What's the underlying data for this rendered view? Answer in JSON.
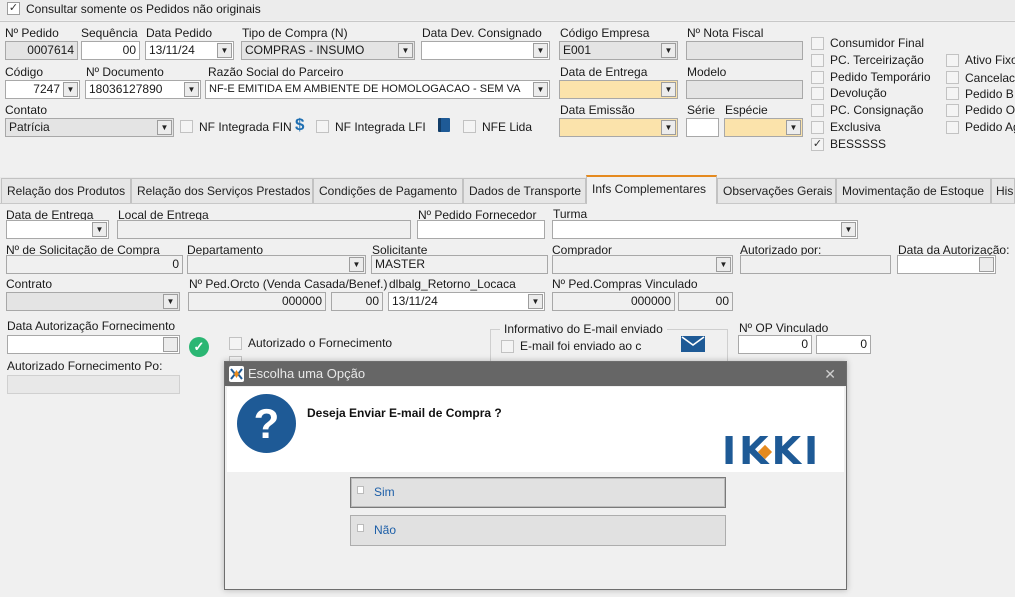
{
  "top_bar": {
    "checkbox_label": "Consultar somente os Pedidos não originais",
    "checked": true
  },
  "header": {
    "labels": {
      "pedido": "Nº Pedido",
      "sequencia": "Sequência",
      "data_pedido": "Data Pedido",
      "tipo_compra": "Tipo de Compra (N)",
      "data_dev": "Data Dev. Consignado",
      "codigo_empresa": "Código Empresa",
      "nota_fiscal": "Nº Nota Fiscal",
      "codigo": "Código",
      "documento": "Nº Documento",
      "razao_social": "Razão Social do Parceiro",
      "data_entrega": "Data de Entrega",
      "modelo": "Modelo",
      "contato": "Contato",
      "data_emissao": "Data Emissão",
      "serie": "Série",
      "especie": "Espécie"
    },
    "values": {
      "pedido": "0007614",
      "sequencia": "00",
      "data_pedido": "13/11/24",
      "tipo_compra": "COMPRAS - INSUMO",
      "data_dev": "",
      "codigo_empresa": "E001",
      "nota_fiscal": "",
      "codigo": "7247",
      "documento": "18036127890",
      "razao_social": "NF-E EMITIDA EM AMBIENTE DE HOMOLOGACAO - SEM VA",
      "data_entrega": "",
      "modelo": "",
      "contato": "Patrícia",
      "data_emissao": "",
      "serie": "",
      "especie": ""
    },
    "nf_checks": [
      {
        "label": "NF Integrada FIN",
        "icon": "dollar-icon"
      },
      {
        "label": "NF Integrada LFI",
        "icon": "book-icon"
      },
      {
        "label": "NFE Lida"
      }
    ]
  },
  "right_checks": [
    {
      "label": "Consumidor Final",
      "checked": false
    },
    {
      "label": "PC. Terceirização",
      "checked": false
    },
    {
      "label": "Pedido Temporário",
      "checked": false
    },
    {
      "label": "Devolução",
      "checked": false
    },
    {
      "label": "PC. Consignação",
      "checked": false
    },
    {
      "label": "Exclusiva",
      "checked": false
    },
    {
      "label": "BESSSSS",
      "checked": true
    }
  ],
  "far_right_checks": [
    "Ativo Fixo",
    "Cancelac",
    "Pedido B",
    "Pedido O",
    "Pedido Ag"
  ],
  "tabs": [
    {
      "label": "Relação dos Produtos"
    },
    {
      "label": "Relação dos Serviços Prestados"
    },
    {
      "label": "Condições de Pagamento"
    },
    {
      "label": "Dados de Transporte"
    },
    {
      "label": "Infs Complementares",
      "active": true
    },
    {
      "label": "Observações Gerais"
    },
    {
      "label": "Movimentação de Estoque"
    },
    {
      "label": "His"
    }
  ],
  "complementares": {
    "labels": {
      "data_entrega": "Data de Entrega",
      "local_entrega": "Local de Entrega",
      "pedido_fornecedor": "Nº Pedido Fornecedor",
      "turma": "Turma",
      "solicitacao": "Nº de Solicitação de Compra",
      "departamento": "Departamento",
      "solicitante": "Solicitante",
      "comprador": "Comprador",
      "autorizado_por": "Autorizado por:",
      "data_autorizacao": "Data da Autorização:",
      "contrato": "Contrato",
      "ped_orcto": "Nº Ped.Orcto (Venda Casada/Benef.)",
      "dlbalg": "dlbalg_Retorno_Locaca",
      "ped_compras_vinc": "Nº Ped.Compras Vinculado",
      "data_aut_fornec": "Data Autorização Fornecimento",
      "aut_fornec_po": "Autorizado Fornecimento Po:",
      "autorizado_fornec": "Autorizado o Fornecimento",
      "informativo": "Informativo do E-mail enviado",
      "email_enviado": "E-mail foi enviado ao c",
      "op_vinculado": "Nº OP Vinculado"
    },
    "values": {
      "solicitacao": "0",
      "solicitante": "MASTER",
      "ped_orcto": "000000",
      "ped_orcto_seq": "00",
      "dlbalg": "13/11/24",
      "ped_compras_vinc": "000000",
      "ped_compras_seq": "00",
      "op_vinculado_1": "0",
      "op_vinculado_2": "0"
    }
  },
  "dialog": {
    "title": "Escolha uma Opção",
    "message": "Deseja Enviar E-mail de Compra ?",
    "logo_text": "IKKI",
    "buttons": [
      "Sim",
      "Não"
    ]
  },
  "colors": {
    "accent": "#e58a1f",
    "dialog_title_bg": "#666666",
    "question_icon": "#1e5a96",
    "logo": "#1e5a96",
    "input_yellow": "#fbe3ab",
    "check_green": "#2bb673"
  }
}
